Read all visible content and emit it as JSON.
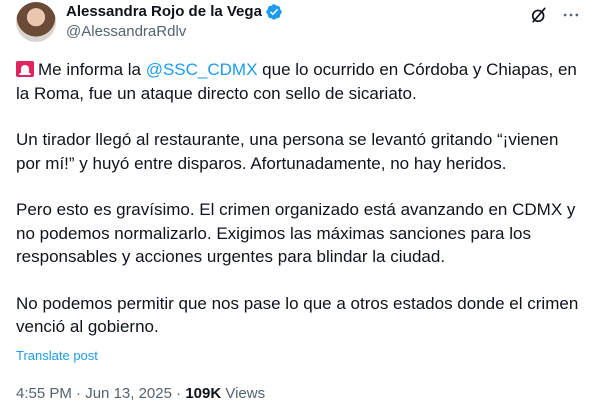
{
  "author": {
    "display_name": "Alessandra Rojo de la Vega",
    "handle": "@AlessandraRdlv",
    "verified_icon": "verified-badge-icon",
    "badge_color": "#1d9bf0"
  },
  "actions": {
    "grok_icon": "grok-slash-circle-icon",
    "more_icon": "more-dots-icon"
  },
  "post": {
    "p1_pre": "Me informa la ",
    "p1_mention": "@SSC_CDMX",
    "p1_post": " que lo ocurrido en Córdoba y Chiapas, en la Roma, fue un ataque directo con sello de sicariato.",
    "p2": "Un tirador llegó al restaurante, una persona se levantó gritando “¡vienen por mí!” y huyó entre disparos. Afortunadamente, no hay heridos.",
    "p3": "Pero esto es gravísimo. El crimen organizado está avanzando en CDMX y no podemos normalizarlo. Exigimos las máximas sanciones para los responsables y acciones urgentes para blindar la ciudad.",
    "p4": "No podemos permitir que nos pase lo que a otros estados donde el crimen venció al gobierno.",
    "emoji_icon": "siren-icon"
  },
  "translate_label": "Translate post",
  "meta": {
    "time": "4:55 PM",
    "sep1": " · ",
    "date": "Jun 13, 2025",
    "sep2": " · ",
    "views_count": "109K",
    "views_label": " Views"
  },
  "colors": {
    "text": "#0f1419",
    "secondary": "#536471",
    "link": "#1d9bf0",
    "siren": "#e0245e"
  }
}
